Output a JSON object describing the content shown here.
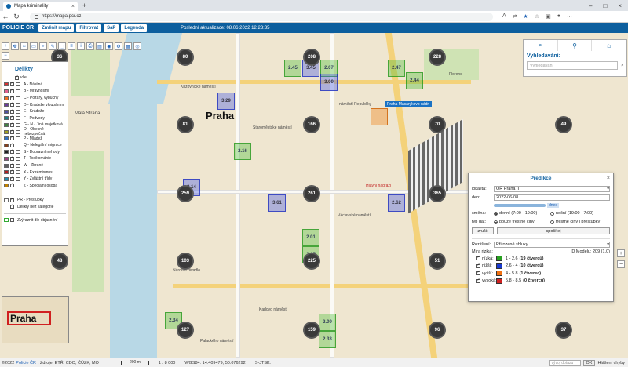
{
  "browser": {
    "tab_title": "Mapa kriminality",
    "url": "https://mapa.pcr.cz"
  },
  "app": {
    "brand": "POLICIE ČR",
    "buttons": [
      "Změnit mapu",
      "Filtrovat",
      "SaP",
      "Legenda"
    ],
    "last_update": "Poslední aktualizace: 08.06.2022 12:23:35"
  },
  "legend": {
    "title": "Delikty",
    "all_label": "vše",
    "items": [
      {
        "label": "A - Násilná",
        "color": "#d83030"
      },
      {
        "label": "B - Mravnostní",
        "color": "#e06090"
      },
      {
        "label": "C - Požáry, výbuchy",
        "color": "#f07020"
      },
      {
        "label": "D - Krádeže vloupáním",
        "color": "#6a3a9a"
      },
      {
        "label": "E - Krádeže",
        "color": "#5050a0"
      },
      {
        "label": "F - Podvody",
        "color": "#208080"
      },
      {
        "label": "G - N - Jiná majetková",
        "color": "#408040"
      },
      {
        "label": "O - Obecně nebezpečná",
        "color": "#a0a020"
      },
      {
        "label": "P - Mládež",
        "color": "#3070c0"
      },
      {
        "label": "Q - Nelegální migrace",
        "color": "#804020"
      },
      {
        "label": "S - Dopravní nehody",
        "color": "#202020"
      },
      {
        "label": "T - Toxikománie",
        "color": "#a04080"
      },
      {
        "label": "W - Zbraně",
        "color": "#606060"
      },
      {
        "label": "X - Extrémismus",
        "color": "#b02020"
      },
      {
        "label": "Y - Zvláštní třídy",
        "color": "#2090b0"
      },
      {
        "label": "Z - Speciální osoba",
        "color": "#c08000"
      }
    ],
    "extra": [
      {
        "label": "PR - Přestupky"
      },
      {
        "label": "Delikty bez kategorie"
      }
    ],
    "zoom_label": "Zvýraznit dle objasnění"
  },
  "minimap": {
    "label": "Praha"
  },
  "map": {
    "city_label": "Praha",
    "clusters": [
      "36",
      "80",
      "208",
      "228",
      "81",
      "166",
      "70",
      "49",
      "259",
      "261",
      "365",
      "103",
      "48",
      "225",
      "51",
      "127",
      "159",
      "96",
      "37"
    ],
    "cells": [
      "2.45",
      "3.45",
      "2.07",
      "2.47",
      "2.44",
      "3.09",
      "3.29",
      "2.16",
      "3.14",
      "3.61",
      "2.62",
      "2.01",
      "2.15",
      "2.34",
      "2.09",
      "2.33"
    ],
    "labels": [
      "Malá Strana",
      "Křižovnické náměstí",
      "Staroměstské náměstí",
      "Hlavní nádraží",
      "Florenc",
      "Karlovo náměstí",
      "náměstí Republiky",
      "Václavské náměstí",
      "Národní divadlo",
      "Palackého náměstí",
      "Praha Masarykovo nádr."
    ]
  },
  "search": {
    "title": "Vyhledávání:",
    "placeholder": "Vyhledávání"
  },
  "prediction": {
    "title": "Predikce",
    "lokalita_label": "lokalita:",
    "lokalita_value": "OŘ Praha II",
    "den_label": "den:",
    "den_value": "2022-06-08",
    "slider_label": "dnes",
    "smena_label": "směna:",
    "smena_opt1": "denní (7:00 - 19:00)",
    "smena_opt2": "noční (19:00 - 7:00)",
    "typ_label": "typ dat:",
    "typ_opt1": "pouze trestné činy",
    "typ_opt2": "trestné činy i přestupky",
    "btn_cancel": "zrušit",
    "btn_compute": "spočítej",
    "rozliseni_label": "Rozlišení:",
    "rozliseni_value": "Přirozené shluky",
    "mira_label": "Míra rizika:",
    "model_id": "ID Modelu: 209 (1.0)",
    "levels": [
      {
        "name": "nízká:",
        "color": "#28a020",
        "range": "1 - 2.6",
        "count": "(19 čtverců)"
      },
      {
        "name": "nižší:",
        "color": "#1a3ad0",
        "range": "2.6 - 4",
        "count": "(10 čtverců)"
      },
      {
        "name": "vyšší:",
        "color": "#f07010",
        "range": "4 - 5.8",
        "count": "(1 čtverec)"
      },
      {
        "name": "vysoká:",
        "color": "#d02020",
        "range": "5.8 - 8.5",
        "count": "(0 čtverců)"
      }
    ]
  },
  "status": {
    "copyright": "©2022",
    "link": "Policie ČR",
    "sources": ", Zdroje: ETŘ, CDO, ČÚZK, MO",
    "scale": "200 m",
    "ratio": "1 : 8 000",
    "coords": "WGS84: 14.409479, 50.076292",
    "sjtsk": "S-JTSK:",
    "date_placeholder": "vývoj dotazu",
    "ok": "OK",
    "help": "Hlášení chyby"
  }
}
